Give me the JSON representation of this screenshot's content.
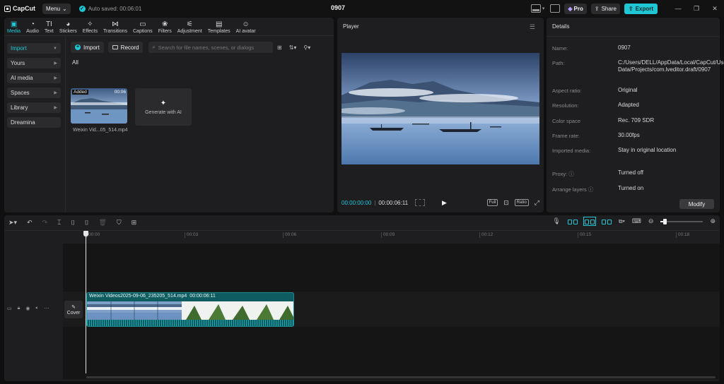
{
  "titlebar": {
    "app_name": "CapCut",
    "menu_label": "Menu",
    "autosave_text": "Auto saved: 00:06:01",
    "project_title": "0907",
    "pro_label": "Pro",
    "share_label": "Share",
    "export_label": "Export"
  },
  "toolbar": {
    "tabs": [
      {
        "label": "Media",
        "icon": "media-icon"
      },
      {
        "label": "Audio",
        "icon": "audio-icon"
      },
      {
        "label": "Text",
        "icon": "text-icon"
      },
      {
        "label": "Stickers",
        "icon": "stickers-icon"
      },
      {
        "label": "Effects",
        "icon": "effects-icon"
      },
      {
        "label": "Transitions",
        "icon": "transitions-icon"
      },
      {
        "label": "Captions",
        "icon": "captions-icon"
      },
      {
        "label": "Filters",
        "icon": "filters-icon"
      },
      {
        "label": "Adjustment",
        "icon": "adjustment-icon"
      },
      {
        "label": "Templates",
        "icon": "templates-icon"
      },
      {
        "label": "AI avatar",
        "icon": "ai-avatar-icon"
      }
    ]
  },
  "sidebar": {
    "items": [
      {
        "label": "Import"
      },
      {
        "label": "Yours"
      },
      {
        "label": "AI media"
      },
      {
        "label": "Spaces"
      },
      {
        "label": "Library"
      },
      {
        "label": "Dreamina"
      }
    ]
  },
  "media": {
    "import_label": "Import",
    "record_label": "Record",
    "search_placeholder": "Search for file names, scenes, or dialogs",
    "filter_label": "All",
    "clip": {
      "badge": "Added",
      "duration": "00:06",
      "name": "Weixin Vid...05_514.mp4"
    },
    "generate_label": "Generate with AI"
  },
  "player": {
    "title": "Player",
    "current_time": "00:00:00:00",
    "total_time": "00:00:06:11",
    "full_label": "Full",
    "ratio_label": "Ratio"
  },
  "details": {
    "title": "Details",
    "rows": [
      {
        "label": "Name:",
        "value": "0907"
      },
      {
        "label": "Path:",
        "value": "C:/Users/DELL/AppData/Local/CapCut/User Data/Projects/com.lveditor.draft/0907"
      },
      {
        "label": "Aspect ratio:",
        "value": "Original"
      },
      {
        "label": "Resolution:",
        "value": "Adapted"
      },
      {
        "label": "Color space",
        "value": "Rec. 709 SDR"
      },
      {
        "label": "Frame rate:",
        "value": "30.00fps"
      },
      {
        "label": "Imported media:",
        "value": "Stay in original location"
      },
      {
        "label": "Proxy:",
        "value": "Turned off"
      },
      {
        "label": "Arrange layers",
        "value": "Turned on"
      }
    ],
    "modify_label": "Modify"
  },
  "timeline": {
    "ruler_labels": [
      "00:00",
      "00:03",
      "00:06",
      "00:09",
      "00:12",
      "00:15",
      "00:18"
    ],
    "clip_name": "Weixin Videos2025-09-06_235205_514.mp4",
    "clip_duration": "00:00:06:11",
    "cover_label": "Cover",
    "zoom_level": 0.1
  },
  "colors": {
    "accent": "#1fc7d4",
    "panel": "#1e1e20",
    "background": "#0f0f10"
  }
}
